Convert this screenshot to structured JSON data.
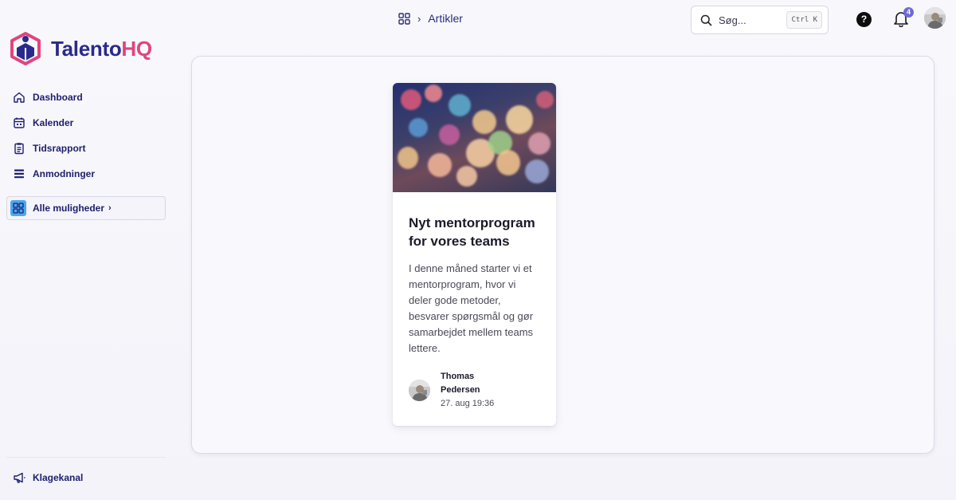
{
  "app": {
    "logo_main": "Talento",
    "logo_accent": "HQ"
  },
  "sidebar": {
    "items": [
      {
        "label": "Dashboard",
        "icon": "home-icon"
      },
      {
        "label": "Kalender",
        "icon": "calendar-icon"
      },
      {
        "label": "Tidsrapport",
        "icon": "clipboard-icon"
      },
      {
        "label": "Anmodninger",
        "icon": "list-icon"
      }
    ],
    "all_options": {
      "label": "Alle muligheder",
      "icon": "grid-icon"
    },
    "bottom": {
      "label": "Klagekanal",
      "icon": "megaphone-icon"
    }
  },
  "header": {
    "breadcrumb": {
      "icon": "grid-icon",
      "current": "Artikler"
    },
    "search": {
      "placeholder": "Søg...",
      "shortcut": "Ctrl K"
    },
    "notifications_count": "4",
    "help_label": "?"
  },
  "article": {
    "title": "Nyt mentorprogram for vores teams",
    "excerpt": "I denne måned starter vi et mentorprogram, hvor vi deler gode metoder, besvarer spørgsmål og gør samarbejdet mellem teams lettere.",
    "author": "Thomas Pedersen",
    "date": "27. aug 19:36"
  },
  "colors": {
    "brand_primary": "#2a2a8c",
    "brand_accent": "#e0457b",
    "badge": "#6f69d9",
    "grid_icon_bg": "#4aa8f0"
  }
}
